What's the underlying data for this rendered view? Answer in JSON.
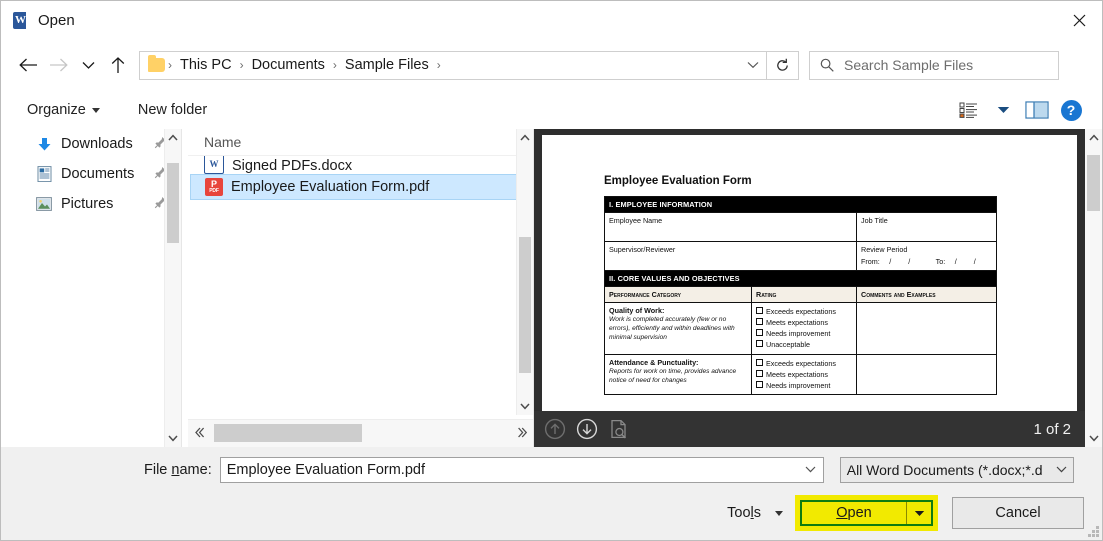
{
  "window": {
    "title": "Open",
    "app_icon": "word-icon",
    "close_label": "✕"
  },
  "nav": {
    "back_icon": "arrow-left-icon",
    "forward_icon": "arrow-right-icon",
    "recent_icon": "chevron-down-icon",
    "up_icon": "arrow-up-icon",
    "refresh_icon": "refresh-icon",
    "breadcrumbs": [
      "This PC",
      "Documents",
      "Sample Files"
    ],
    "separator": "›"
  },
  "search": {
    "placeholder": "Search Sample Files",
    "value": "",
    "icon": "search-icon"
  },
  "commandbar": {
    "organize_label": "Organize",
    "new_folder_label": "New folder",
    "view_icon": "view-list-icon",
    "view_caret": "chevron-down-icon",
    "pane_icon": "preview-pane-icon",
    "help_label": "?"
  },
  "sidebar": {
    "items": [
      {
        "label": "Downloads",
        "icon": "download-arrow-icon",
        "pin": "pin-icon"
      },
      {
        "label": "Documents",
        "icon": "document-icon",
        "pin": "pin-icon"
      },
      {
        "label": "Pictures",
        "icon": "picture-icon",
        "pin": "pin-icon"
      }
    ]
  },
  "filelist": {
    "column_header": "Name",
    "files": [
      {
        "name": "Signed PDFs.docx",
        "type": "word",
        "selected": false,
        "clipped": true
      },
      {
        "name": "Employee Evaluation Form.pdf",
        "type": "pdf",
        "selected": true,
        "clipped": false
      }
    ]
  },
  "preview": {
    "page_indicator": "1 of 2",
    "prev_icon": "arrow-up-circle-icon",
    "next_icon": "arrow-down-circle-icon",
    "fit_icon": "page-zoom-icon",
    "document": {
      "title": "Employee Evaluation Form",
      "section1": "I. EMPLOYEE INFORMATION",
      "fields": [
        [
          "Employee Name",
          "Job Title"
        ],
        [
          "Supervisor/Reviewer",
          "Review Period"
        ]
      ],
      "review_period_line": "From:      /        /        To:      /        /",
      "review_from_label": "From:",
      "review_to_label": "To:",
      "slash": "/",
      "section2": "II. CORE VALUES AND OBJECTIVES",
      "table_headers": [
        "Performance Category",
        "Rating",
        "Comments and Examples"
      ],
      "rows": [
        {
          "category": "Quality of Work:",
          "description": "Work is completed accurately (few or no errors), efficiently and within deadlines with minimal supervision",
          "ratings": [
            "Exceeds expectations",
            "Meets expectations",
            "Needs improvement",
            "Unacceptable"
          ],
          "comments": ""
        },
        {
          "category": "Attendance & Punctuality:",
          "description": "Reports for work on time, provides advance notice of need for changes",
          "ratings": [
            "Exceeds expectations",
            "Meets expectations",
            "Needs improvement"
          ],
          "comments": ""
        }
      ]
    }
  },
  "footer": {
    "filename_label_pre": "File ",
    "filename_label_accel": "n",
    "filename_label_post": "ame:",
    "filename_value": "Employee Evaluation Form.pdf",
    "filetype_value": "All Word Documents (*.docx;*.d",
    "tools_label_pre": "Too",
    "tools_label_accel": "l",
    "tools_label_post": "s",
    "open_label_pre": "",
    "open_label_accel": "O",
    "open_label_post": "pen",
    "cancel_label": "Cancel"
  },
  "colors": {
    "accent": "#1976d2",
    "selection": "#cde8ff",
    "highlight_yellow": "#f2ea00",
    "highlight_border_green": "#107c10",
    "word_blue": "#2b579a",
    "pdf_red": "#e8453c"
  }
}
